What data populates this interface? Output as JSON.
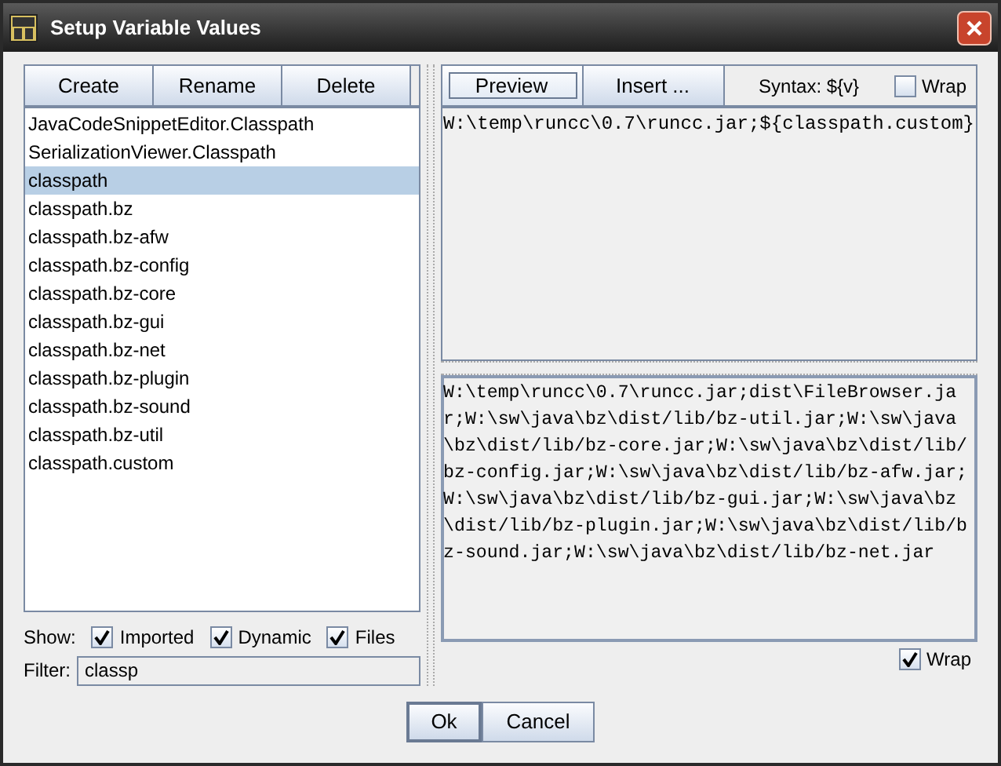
{
  "window": {
    "title": "Setup Variable Values"
  },
  "left_toolbar": [
    "Create",
    "Rename",
    "Delete"
  ],
  "variables": [
    {
      "label": "JavaCodeSnippetEditor.Classpath",
      "selected": false
    },
    {
      "label": "SerializationViewer.Classpath",
      "selected": false
    },
    {
      "label": "classpath",
      "selected": true
    },
    {
      "label": "classpath.bz",
      "selected": false
    },
    {
      "label": "classpath.bz-afw",
      "selected": false
    },
    {
      "label": "classpath.bz-config",
      "selected": false
    },
    {
      "label": "classpath.bz-core",
      "selected": false
    },
    {
      "label": "classpath.bz-gui",
      "selected": false
    },
    {
      "label": "classpath.bz-net",
      "selected": false
    },
    {
      "label": "classpath.bz-plugin",
      "selected": false
    },
    {
      "label": "classpath.bz-sound",
      "selected": false
    },
    {
      "label": "classpath.bz-util",
      "selected": false
    },
    {
      "label": "classpath.custom",
      "selected": false
    }
  ],
  "show": {
    "label": "Show:",
    "options": [
      {
        "label": "Imported",
        "checked": true
      },
      {
        "label": "Dynamic",
        "checked": true
      },
      {
        "label": "Files",
        "checked": true
      }
    ]
  },
  "filter": {
    "label": "Filter:",
    "value": "classp"
  },
  "right_toolbar": {
    "buttons": [
      {
        "label": "Preview",
        "selected": true
      },
      {
        "label": "Insert ...",
        "selected": false
      }
    ],
    "syntax": "Syntax: ${v}",
    "wrap": {
      "label": "Wrap",
      "checked": false
    }
  },
  "editor": {
    "value": "W:\\temp\\runcc\\0.7\\runcc.jar;${classpath.custom}"
  },
  "preview": {
    "value": "W:\\temp\\runcc\\0.7\\runcc.jar;dist\\FileBrowser.jar;W:\\sw\\java\\bz\\dist/lib/bz-util.jar;W:\\sw\\java\\bz\\dist/lib/bz-core.jar;W:\\sw\\java\\bz\\dist/lib/bz-config.jar;W:\\sw\\java\\bz\\dist/lib/bz-afw.jar;W:\\sw\\java\\bz\\dist/lib/bz-gui.jar;W:\\sw\\java\\bz\\dist/lib/bz-plugin.jar;W:\\sw\\java\\bz\\dist/lib/bz-sound.jar;W:\\sw\\java\\bz\\dist/lib/bz-net.jar",
    "wrap": {
      "label": "Wrap",
      "checked": true
    }
  },
  "buttons": [
    "Ok",
    "Cancel"
  ]
}
